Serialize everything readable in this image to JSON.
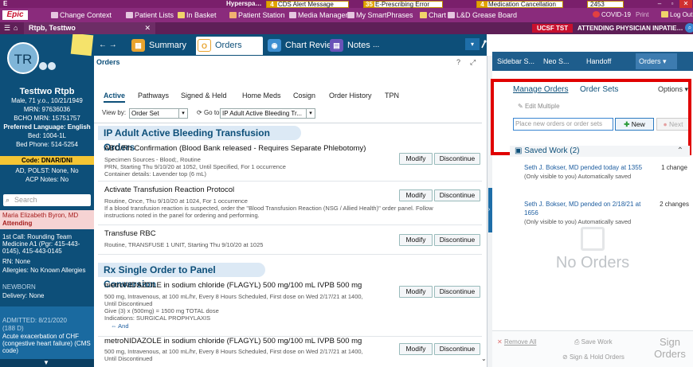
{
  "titlebar": {
    "system_label": "E",
    "title": "Hyperspace - NEO",
    "alerts": [
      {
        "count": "4",
        "label": "CDS Alert Message"
      },
      {
        "count": "35",
        "label": "E-Prescribing Error"
      },
      {
        "count": "4",
        "label": "Medication Cancellation"
      },
      {
        "count": "2453",
        "label": ""
      }
    ],
    "window_controls": {
      "minimize": "–",
      "maximize": "▫",
      "close": "✕"
    }
  },
  "menubar": {
    "logo": "Epic",
    "items": [
      "Change Context",
      "Patient Lists",
      "In Basket",
      "Patient Station",
      "Media Manager",
      "My SmartPhrases",
      "Chart",
      "L&D Grease Board"
    ],
    "right_items": [
      "COVID-19",
      "Print",
      "Log Out"
    ]
  },
  "patient_tab": {
    "name": "Rtpb, Testtwo",
    "close": "✕"
  },
  "context": {
    "site": "UCSF TST",
    "role": "ATTENDING PHYSICIAN INPATIENT"
  },
  "sidebar": {
    "initials": "TR",
    "name": "Testtwo Rtpb",
    "demographics": "Male, 71 y.o., 10/21/1949",
    "mrn": "MRN: 97636036",
    "bcho_mrn": "BCHO MRN: 15751757",
    "language": "Preferred Language: English",
    "bed": "Bed: 1004-1L",
    "bed_phone": "Bed Phone: 514-5254",
    "code": "Code: DNAR/DNI",
    "ad_polst": "AD, POLST: None, No",
    "acp_notes": "ACP Notes: No",
    "search_placeholder": "Search",
    "provider": "Maria Elizabeth Byron, MD",
    "provider_role": "Attending",
    "first_call": "1st Call: Rounding Team Medicine A1 (Pgr: 415-443-0145), 415-443-0145",
    "rn": "RN: None",
    "allergies": "Allergies: No Known Allergies",
    "newborn_label": "NEWBORN",
    "delivery": "Delivery: None",
    "admitted": "ADMITTED: 8/21/2020",
    "los": "(188 D)",
    "diagnosis": "Acute exacerbation of CHF (congestive heart failure) (CMS code)"
  },
  "nav": {
    "back_forward": "← →",
    "tabs": [
      {
        "label": "Summary",
        "icon": "summary-icon"
      },
      {
        "label": "Orders",
        "icon": "orders-icon"
      },
      {
        "label": "Chart Review",
        "icon": "chart-review-icon"
      },
      {
        "label": "Notes",
        "icon": "notes-icon"
      }
    ],
    "more": "...",
    "dropdown": "▾"
  },
  "orders_panel": {
    "title": "Orders",
    "tabs": [
      "Active",
      "Pathways",
      "Signed & Held",
      "Home Meds",
      "Cosign",
      "Order History",
      "TPN"
    ],
    "view_by_label": "View by:",
    "view_by_value": "Order Set",
    "go_to_label": "Go to:",
    "go_to_value": "IP Adult Active Bleeding Tr...",
    "modify_label": "Modify",
    "discontinue_label": "Discontinue",
    "groups": [
      {
        "title": "IP Adult Active Bleeding Transfusion Orders",
        "orders": [
          {
            "name": "ABO/Rh Confirmation (Blood Bank released - Requires Separate Phlebotomy)",
            "lines": [
              "Specimen Sources - Blood;, Routine",
              "PRN, Starting Thu 9/10/20 at 1052, Until Specified, For 1 occurrence",
              "Container details: Lavender top (6 mL)"
            ]
          },
          {
            "name": "Activate Transfusion Reaction Protocol",
            "lines": [
              "Routine, Once, Thu 9/10/20 at 1024, For 1 occurrence",
              "If a blood transfusion reaction is suspected, order the \"Blood Transfusion Reaction (NSG / Allied Health)\" order panel. Follow",
              "instructions noted in the panel for ordering and performing."
            ]
          },
          {
            "name": "Transfuse RBC",
            "lines": [
              "Routine, TRANSFUSE 1 UNIT, Starting Thu 9/10/20 at 1025"
            ]
          }
        ]
      },
      {
        "title": "Rx Single Order to Panel Conversion",
        "orders": [
          {
            "name": "metroNIDAZOLE in sodium chloride (FLAGYL) 500 mg/100 mL IVPB 500 mg",
            "lines": [
              "500 mg, Intravenous, at 100 mL/hr, Every 8 Hours Scheduled, First dose on Wed 2/17/21 at 1400,",
              "Until Discontinued",
              "Give (3) x (500mg) = 1500 mg TOTAL dose",
              "Indications: SURGICAL PROPHYLAXIS"
            ],
            "and_label": "And"
          },
          {
            "name": "metroNIDAZOLE in sodium chloride (FLAGYL) 500 mg/100 mL IVPB 500 mg",
            "lines": [
              "500 mg, Intravenous, at 100 mL/hr, Every 8 Hours Scheduled, First dose on Wed 2/17/21 at 1400,",
              "Until Discontinued"
            ]
          }
        ]
      }
    ]
  },
  "right_panel": {
    "tabs": [
      "Sidebar S...",
      "Neo S...",
      "Handoff",
      "Orders"
    ],
    "manage_orders": "Manage Orders",
    "order_sets": "Order Sets",
    "options": "Options ▾",
    "edit_multiple": "Edit Multiple",
    "place_placeholder": "Place new orders or order sets",
    "new_label": "New",
    "next_label": "Next",
    "saved_work_title": "Saved Work (2)",
    "saved_items": [
      {
        "title": "Seth J. Bokser, MD pended today at 1355",
        "sub": "(Only visible to you) Automatically saved",
        "count": "1 change"
      },
      {
        "title": "Seth J. Bokser, MD pended on 2/18/21 at 1656",
        "sub": "(Only visible to you) Automatically saved",
        "count": "2 changes"
      }
    ],
    "no_orders": "No Orders",
    "remove_all": "Remove All",
    "save_work": "Save Work",
    "sign_hold": "Sign & Hold Orders",
    "sign_orders": "Sign Orders"
  },
  "colors": {
    "epic_purple": "#8a2b7c",
    "sidebar_blue": "#0d4f79",
    "alert_red": "#e00000"
  }
}
